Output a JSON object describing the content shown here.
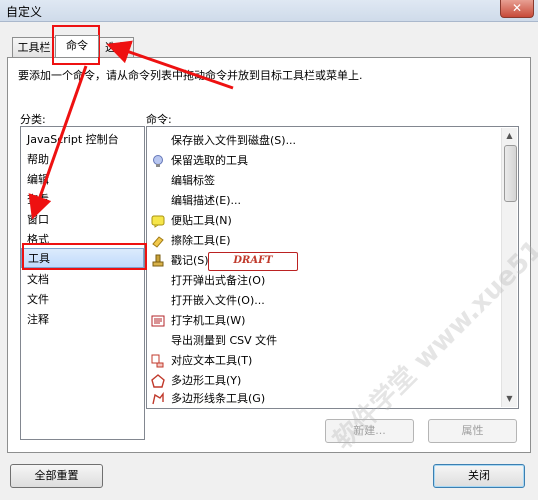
{
  "window": {
    "title": "自定义",
    "close_glyph": "✕"
  },
  "tabs": [
    {
      "label": "工具栏"
    },
    {
      "label": "命令"
    },
    {
      "label": "选项"
    }
  ],
  "instruction": "要添加一个命令，请从命令列表中拖动命令并放到目标工具栏或菜单上.",
  "categories": {
    "label": "分类:",
    "items": [
      "JavaScript 控制台",
      "帮助",
      "编辑",
      "查看",
      "窗口",
      "格式",
      "工具",
      "文档",
      "文件",
      "注释"
    ],
    "selected": "工具"
  },
  "commands": {
    "label": "命令:",
    "items": [
      {
        "text": "保存嵌入文件到磁盘(S)...",
        "icon": "none"
      },
      {
        "text": "保留选取的工具",
        "icon": "lightbulb-icon"
      },
      {
        "text": "编辑标签",
        "icon": "none"
      },
      {
        "text": "编辑描述(E)...",
        "icon": "none"
      },
      {
        "text": "便贴工具(N)",
        "icon": "sticky-note-icon"
      },
      {
        "text": "擦除工具(E)",
        "icon": "eraser-icon"
      },
      {
        "text": "戳记(S)",
        "icon": "stamp-icon",
        "stamp": "DRAFT"
      },
      {
        "text": "打开弹出式备注(O)",
        "icon": "none"
      },
      {
        "text": "打开嵌入文件(O)...",
        "icon": "none"
      },
      {
        "text": "打字机工具(W)",
        "icon": "typewriter-icon"
      },
      {
        "text": "导出测量到 CSV 文件",
        "icon": "none"
      },
      {
        "text": "对应文本工具(T)",
        "icon": "replace-text-icon"
      },
      {
        "text": "多边形工具(Y)",
        "icon": "polygon-icon"
      },
      {
        "text": "多边形线条工具(G)",
        "icon": "polyline-icon"
      }
    ]
  },
  "buttons": {
    "new": "新建...",
    "properties": "属性",
    "reset_all": "全部重置",
    "close": "关闭"
  },
  "watermark": "软件学堂 www.xue51.com",
  "colors": {
    "annotation_red": "#e11111",
    "selection": "#c1dbfc"
  }
}
